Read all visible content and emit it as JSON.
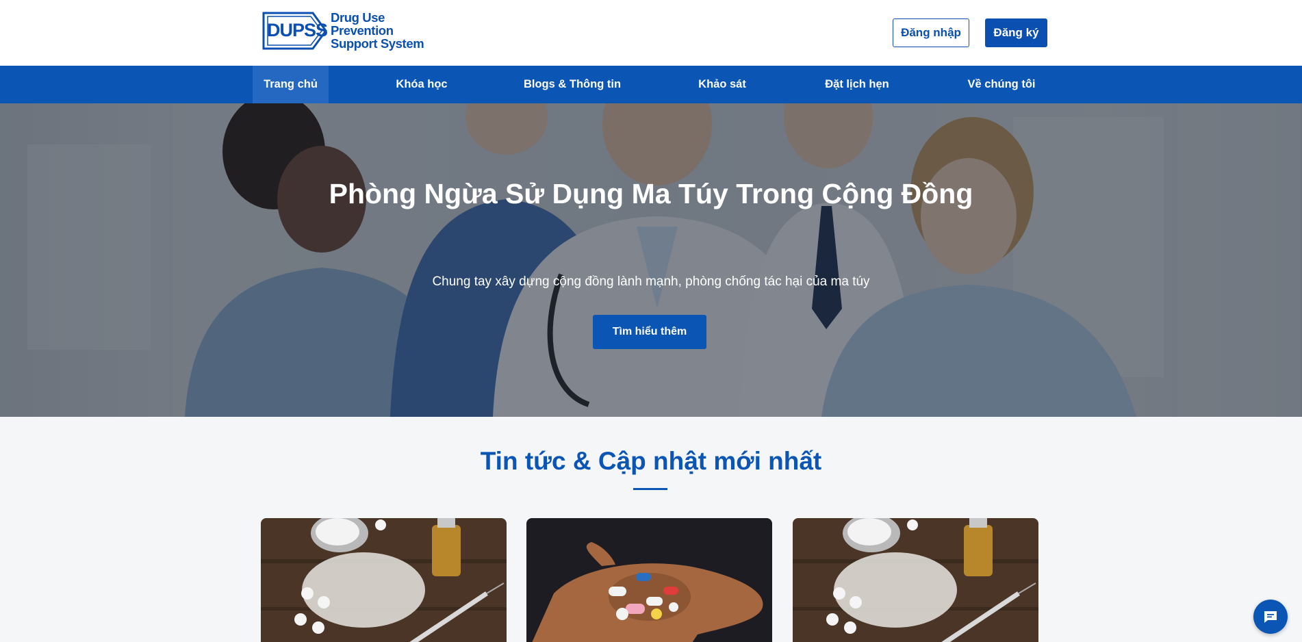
{
  "brand": {
    "badge": "DUPSS",
    "name_lines": [
      "Drug Use",
      "Prevention",
      "Support System"
    ],
    "color": "#0b4fb0"
  },
  "auth": {
    "login_label": "Đăng nhập",
    "register_label": "Đăng ký"
  },
  "nav": {
    "items": [
      {
        "label": "Trang chủ",
        "active": true
      },
      {
        "label": "Khóa học",
        "active": false
      },
      {
        "label": "Blogs & Thông tin",
        "active": false
      },
      {
        "label": "Khảo sát",
        "active": false
      },
      {
        "label": "Đặt lịch hẹn",
        "active": false
      },
      {
        "label": "Về chúng tôi",
        "active": false
      }
    ],
    "color": "#0b55b5"
  },
  "hero": {
    "title": "Phòng Ngừa Sử Dụng Ma Túy Trong Cộng Đồng",
    "subtitle": "Chung tay xây dựng cộng đồng lành mạnh, phòng chống tác hại của ma túy",
    "cta_label": "Tìm hiểu thêm"
  },
  "news": {
    "title": "Tin tức & Cập nhật mới nhất",
    "cards": [
      {
        "image": "drugs-powder-spoon-syringe-photo"
      },
      {
        "image": "hand-holding-pills-photo"
      },
      {
        "image": "drugs-powder-spoon-syringe-photo"
      }
    ]
  },
  "chat": {
    "icon": "chat-bubble-icon"
  }
}
